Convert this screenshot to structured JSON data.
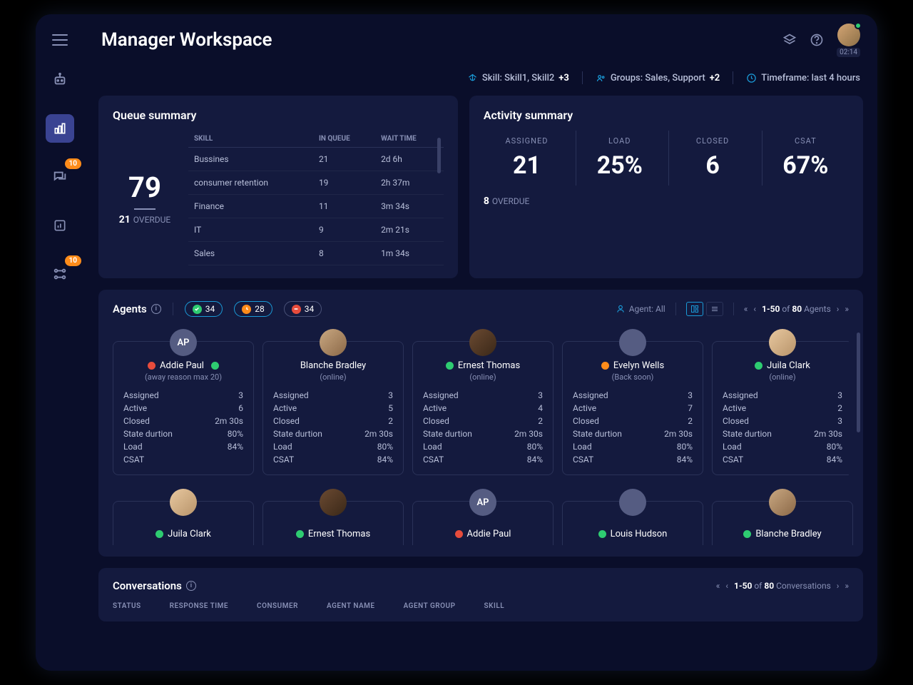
{
  "header": {
    "title": "Manager Workspace",
    "timer": "02:14"
  },
  "filters": {
    "skill_label": "Skill: Skill1, Skill2",
    "skill_extra": "+3",
    "groups_label": "Groups: Sales, Support",
    "groups_extra": "+2",
    "timeframe_label": "Timeframe: last 4 hours"
  },
  "sidebar": {
    "badge_chat": "10",
    "badge_flow": "10"
  },
  "queue": {
    "title": "Queue summary",
    "total": "79",
    "overdue_n": "21",
    "overdue_label": "OVERDUE",
    "cols": {
      "c1": "SKILL",
      "c2": "IN QUEUE",
      "c3": "WAIT TIME"
    },
    "rows": [
      {
        "skill": "Bussines",
        "inq": "21",
        "wait": "2d 6h"
      },
      {
        "skill": "consumer retention",
        "inq": "19",
        "wait": "2h 37m"
      },
      {
        "skill": "Finance",
        "inq": "11",
        "wait": "3m 34s"
      },
      {
        "skill": "IT",
        "inq": "9",
        "wait": "2m 21s"
      },
      {
        "skill": "Sales",
        "inq": "8",
        "wait": "1m 34s"
      }
    ]
  },
  "activity": {
    "title": "Activity summary",
    "cells": [
      {
        "label": "ASSIGNED",
        "value": "21"
      },
      {
        "label": "LOAD",
        "value": "25%"
      },
      {
        "label": "CLOSED",
        "value": "6"
      },
      {
        "label": "CSAT",
        "value": "67%"
      }
    ],
    "overdue_n": "8",
    "overdue_label": "OVERDUE"
  },
  "agents": {
    "title": "Agents",
    "pills": {
      "green": "34",
      "orange": "28",
      "red": "34"
    },
    "filter_label": "Agent: All",
    "pager_from": "1-50",
    "pager_of": " of ",
    "pager_total": "80",
    "pager_suffix": " Agents",
    "stat_labels": {
      "assigned": "Assigned",
      "active": "Active",
      "closed": "Closed",
      "state": "State durtion",
      "load": "Load",
      "csat": "CSAT"
    },
    "cards": [
      {
        "name": "Addie Paul",
        "initials": "AP",
        "status": "(away reason max 20)",
        "dot": "red",
        "dot2": "green",
        "assigned": "3",
        "active": "6",
        "closed": "2m 30s",
        "state": "80%",
        "load": "84%",
        "csat": ""
      },
      {
        "name": "Blanche Bradley",
        "status": "(online)",
        "dot": "",
        "assigned": "3",
        "active": "5",
        "closed": "2",
        "state": "2m 30s",
        "load": "80%",
        "csat": "84%"
      },
      {
        "name": "Ernest Thomas",
        "status": "(online)",
        "dot": "green",
        "assigned": "3",
        "active": "4",
        "closed": "2",
        "state": "2m 30s",
        "load": "80%",
        "csat": "84%"
      },
      {
        "name": "Evelyn Wells",
        "status": "(Back soon)",
        "dot": "orange",
        "assigned": "3",
        "active": "7",
        "closed": "2",
        "state": "2m 30s",
        "load": "80%",
        "csat": "84%"
      },
      {
        "name": "Juila Clark",
        "status": "(online)",
        "dot": "green",
        "assigned": "3",
        "active": "2",
        "closed": "3",
        "state": "2m 30s",
        "load": "80%",
        "csat": "84%"
      }
    ],
    "row2": [
      {
        "name": "Juila Clark",
        "dot": "green"
      },
      {
        "name": "Ernest Thomas",
        "dot": "green"
      },
      {
        "name": "Addie Paul",
        "initials": "AP",
        "dot": "red"
      },
      {
        "name": "Louis Hudson",
        "dot": "green"
      },
      {
        "name": "Blanche Bradley",
        "dot": "green"
      }
    ]
  },
  "conversations": {
    "title": "Conversations",
    "pager_from": "1-50",
    "pager_of": " of ",
    "pager_total": "80",
    "pager_suffix": " Conversations",
    "cols": [
      "STATUS",
      "RESPONSE TIME",
      "CONSUMER",
      "AGENT NAME",
      "AGENT GROUP",
      "SKILL"
    ]
  }
}
